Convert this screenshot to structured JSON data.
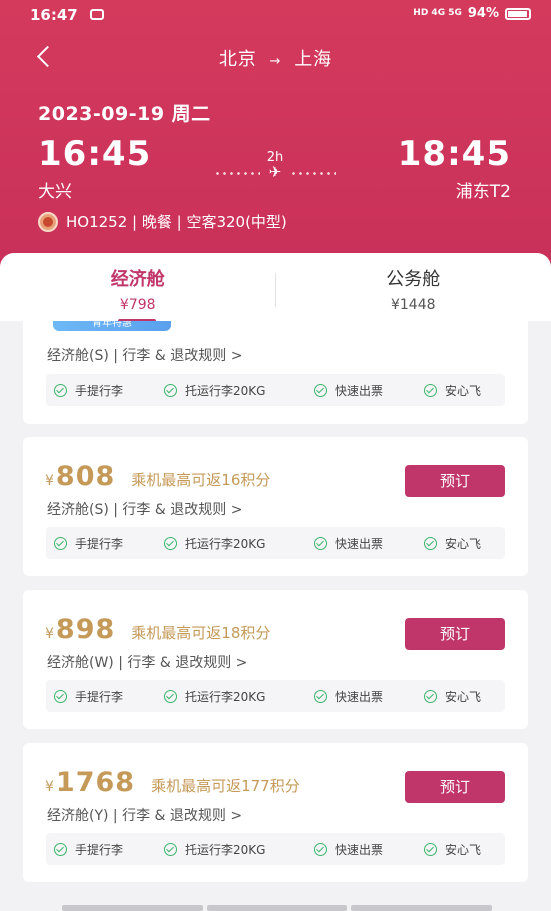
{
  "status": {
    "time": "16:47",
    "network": "HD 4G 5G",
    "battery": "94%"
  },
  "header": {
    "route_from": "北京",
    "route_arrow": "→",
    "route_to": "上海",
    "date": "2023-09-19 周二",
    "dep_time": "16:45",
    "arr_time": "18:45",
    "dep_airport": "大兴",
    "arr_airport": "浦东T2",
    "duration": "2h",
    "flight_info": "HO1252 | 晚餐 | 空客320(中型)"
  },
  "tabs": [
    {
      "name": "经济舱",
      "price": "¥798"
    },
    {
      "name": "公务舱",
      "price": "¥1448"
    }
  ],
  "promo_tag": "青年特惠",
  "features": [
    "手提行李",
    "托运行李20KG",
    "快速出票",
    "安心飞"
  ],
  "fares": [
    {
      "rule": "经济舱(S) | 行李 & 退改规则 >"
    },
    {
      "yen": "¥",
      "price": "808",
      "points": "乘机最高可返16积分",
      "rule": "经济舱(S) | 行李 & 退改规则 >",
      "book": "预订"
    },
    {
      "yen": "¥",
      "price": "898",
      "points": "乘机最高可返18积分",
      "rule": "经济舱(W) | 行李 & 退改规则 >",
      "book": "预订"
    },
    {
      "yen": "¥",
      "price": "1768",
      "points": "乘机最高可返177积分",
      "rule": "经济舱(Y) | 行李 & 退改规则 >",
      "book": "预订"
    }
  ],
  "colors": {
    "header": "#d43a5c",
    "accent": "#c1366a",
    "price": "#c59a58",
    "check": "#3bb56a"
  }
}
